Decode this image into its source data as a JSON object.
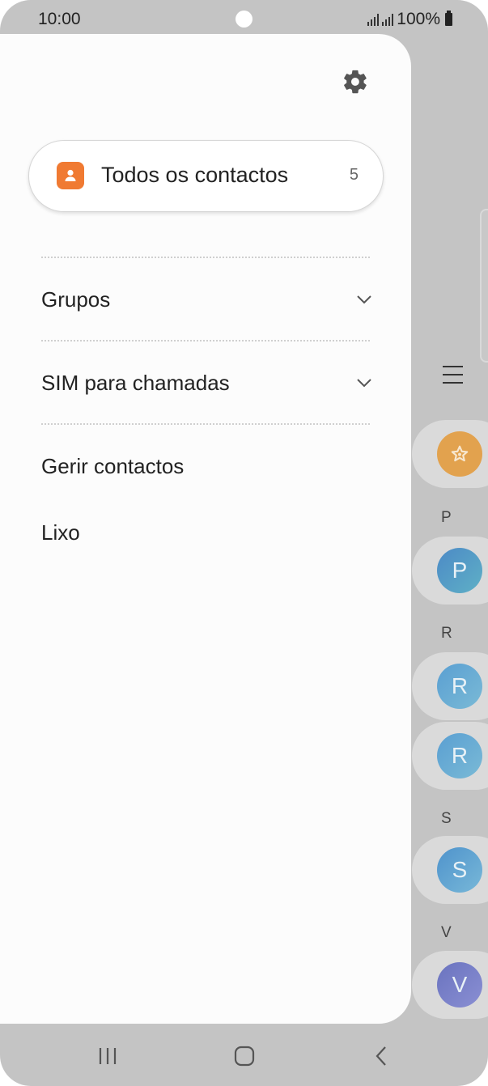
{
  "status_bar": {
    "time": "10:00",
    "battery": "100%"
  },
  "drawer": {
    "settings_icon": "gear-icon",
    "all_contacts": {
      "label": "Todos os contactos",
      "count": "5",
      "icon": "person-icon",
      "icon_color": "#f07a32"
    },
    "sections": [
      {
        "label": "Grupos",
        "icon": "chevron-down-icon"
      },
      {
        "label": "SIM para chamadas",
        "icon": "chevron-down-icon"
      }
    ],
    "items": [
      {
        "label": "Gerir contactos"
      },
      {
        "label": "Lixo"
      }
    ]
  },
  "background_list": {
    "menu_icon": "hamburger-menu-icon",
    "favorite_icon": "star-icon",
    "index_letters": [
      "P",
      "R",
      "S",
      "V"
    ],
    "avatars": [
      "P",
      "R",
      "R",
      "S",
      "V"
    ]
  },
  "nav_bar": {
    "recents_icon": "recents-icon",
    "home_icon": "home-icon",
    "back_icon": "back-icon"
  }
}
